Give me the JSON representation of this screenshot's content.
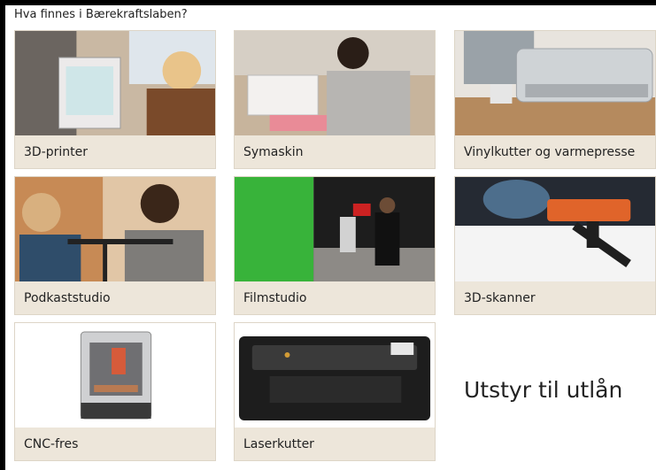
{
  "heading": "Hva finnes i Bærekraftslaben?",
  "cards": [
    {
      "label": "3D-printer"
    },
    {
      "label": "Symaskin"
    },
    {
      "label": "Vinylkutter og varmepresse"
    },
    {
      "label": "Podkaststudio"
    },
    {
      "label": "Filmstudio"
    },
    {
      "label": "3D-skanner"
    },
    {
      "label": "CNC-fres"
    },
    {
      "label": "Laserkutter"
    }
  ],
  "side_text": "Utstyr til utlån",
  "colors": {
    "card_bg": "#ede6da",
    "frame": "#000000"
  }
}
